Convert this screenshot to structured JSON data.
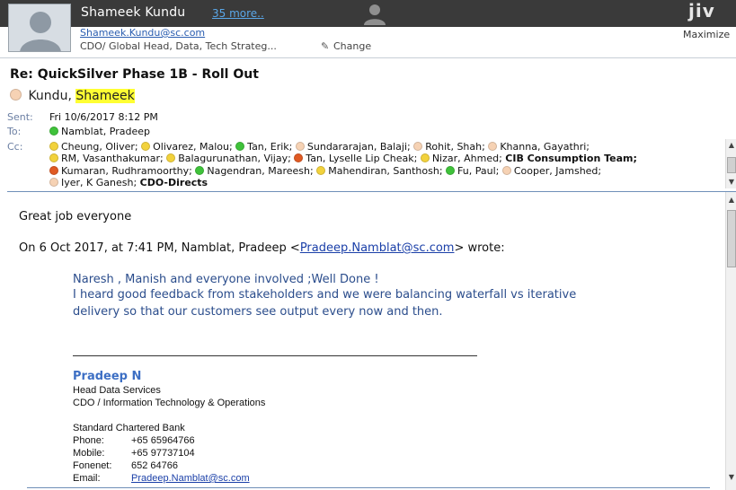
{
  "topbar": {
    "contact_name": "Shameek Kundu",
    "more_link": "35 more..",
    "brand": "jiv",
    "contact_email": "Shameek.Kundu@sc.com",
    "contact_title": "CDO/ Global Head, Data, Tech Strateg...",
    "change_label": "Change",
    "maximize_label": "Maximize"
  },
  "message": {
    "subject": "Re: QuickSilver Phase 1B - Roll Out",
    "from_surname": "Kundu,",
    "from_firstname": "Shameek",
    "sent_label": "Sent:",
    "sent_value": "Fri 10/6/2017 8:12 PM",
    "to_label": "To:",
    "to_value": "Namblat, Pradeep",
    "cc_label": "Cc:"
  },
  "cc_lines": [
    [
      {
        "name": "Cheung, Oliver;",
        "status": "yellow"
      },
      {
        "name": "Olivarez, Malou;",
        "status": "yellow"
      },
      {
        "name": "Tan, Erik;",
        "status": "green"
      },
      {
        "name": "Sundararajan, Balaji;",
        "status": "peach"
      },
      {
        "name": "Rohit, Shah;",
        "status": "peach"
      },
      {
        "name": "Khanna, Gayathri;",
        "status": "peach"
      }
    ],
    [
      {
        "name": "RM, Vasanthakumar;",
        "status": "yellow"
      },
      {
        "name": "Balagurunathan, Vijay;",
        "status": "yellow"
      },
      {
        "name": "Tan, Lyselle Lip Cheak;",
        "status": "red"
      },
      {
        "name": "Nizar, Ahmed;",
        "status": "yellow"
      },
      {
        "name": "CIB Consumption Team;",
        "status": "none",
        "bold": true
      }
    ],
    [
      {
        "name": "Kumaran, Rudhramoorthy;",
        "status": "red"
      },
      {
        "name": "Nagendran, Mareesh;",
        "status": "green"
      },
      {
        "name": "Mahendiran, Santhosh;",
        "status": "yellow"
      },
      {
        "name": "Fu, Paul;",
        "status": "green"
      },
      {
        "name": "Cooper, Jamshed;",
        "status": "peach"
      }
    ],
    [
      {
        "name": "Iyer, K Ganesh;",
        "status": "peach"
      },
      {
        "name": "CDO-Directs",
        "status": "none",
        "bold": true
      }
    ]
  ],
  "status_colors": {
    "green": "#3fc23a",
    "yellow": "#f2d23c",
    "red": "#e05a23",
    "peach": "#f6d2b4"
  },
  "body": {
    "greeting": "Great job everyone",
    "quote_intro_prefix": "On 6 Oct 2017, at 7:41 PM, Namblat, Pradeep <",
    "quote_intro_email": "Pradeep.Namblat@sc.com",
    "quote_intro_suffix": "> wrote:",
    "quote_lines": [
      "Naresh , Manish and everyone involved ;Well Done !",
      "I heard good feedback from stakeholders and we were balancing waterfall vs iterative",
      "delivery so that our customers see output every now and then."
    ],
    "signature": {
      "name": "Pradeep N",
      "role": "Head Data Services",
      "dept": "CDO / Information Technology & Operations",
      "company": "Standard Chartered Bank",
      "phone_label": "Phone:",
      "phone": "+65 65964766",
      "mobile_label": "Mobile:",
      "mobile": "+65 97737104",
      "fonenet_label": "Fonenet:",
      "fonenet": "652 64766",
      "email_label": "Email:",
      "email": "Pradeep.Namblat@sc.com"
    }
  }
}
